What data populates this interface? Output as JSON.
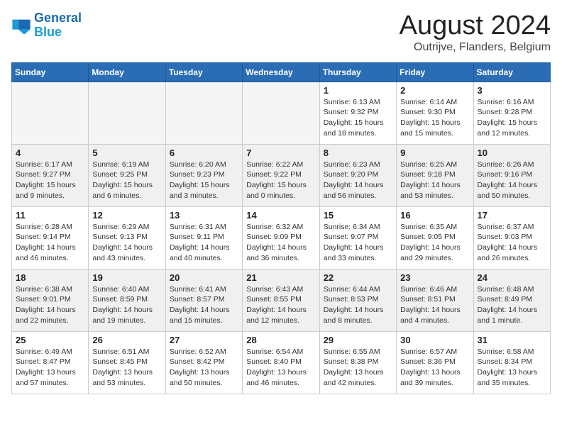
{
  "logo": {
    "line1": "General",
    "line2": "Blue"
  },
  "title": "August 2024",
  "location": "Outrijve, Flanders, Belgium",
  "weekdays": [
    "Sunday",
    "Monday",
    "Tuesday",
    "Wednesday",
    "Thursday",
    "Friday",
    "Saturday"
  ],
  "weeks": [
    [
      {
        "day": "",
        "info": ""
      },
      {
        "day": "",
        "info": ""
      },
      {
        "day": "",
        "info": ""
      },
      {
        "day": "",
        "info": ""
      },
      {
        "day": "1",
        "info": "Sunrise: 6:13 AM\nSunset: 9:32 PM\nDaylight: 15 hours\nand 18 minutes."
      },
      {
        "day": "2",
        "info": "Sunrise: 6:14 AM\nSunset: 9:30 PM\nDaylight: 15 hours\nand 15 minutes."
      },
      {
        "day": "3",
        "info": "Sunrise: 6:16 AM\nSunset: 9:28 PM\nDaylight: 15 hours\nand 12 minutes."
      }
    ],
    [
      {
        "day": "4",
        "info": "Sunrise: 6:17 AM\nSunset: 9:27 PM\nDaylight: 15 hours\nand 9 minutes."
      },
      {
        "day": "5",
        "info": "Sunrise: 6:19 AM\nSunset: 9:25 PM\nDaylight: 15 hours\nand 6 minutes."
      },
      {
        "day": "6",
        "info": "Sunrise: 6:20 AM\nSunset: 9:23 PM\nDaylight: 15 hours\nand 3 minutes."
      },
      {
        "day": "7",
        "info": "Sunrise: 6:22 AM\nSunset: 9:22 PM\nDaylight: 15 hours\nand 0 minutes."
      },
      {
        "day": "8",
        "info": "Sunrise: 6:23 AM\nSunset: 9:20 PM\nDaylight: 14 hours\nand 56 minutes."
      },
      {
        "day": "9",
        "info": "Sunrise: 6:25 AM\nSunset: 9:18 PM\nDaylight: 14 hours\nand 53 minutes."
      },
      {
        "day": "10",
        "info": "Sunrise: 6:26 AM\nSunset: 9:16 PM\nDaylight: 14 hours\nand 50 minutes."
      }
    ],
    [
      {
        "day": "11",
        "info": "Sunrise: 6:28 AM\nSunset: 9:14 PM\nDaylight: 14 hours\nand 46 minutes."
      },
      {
        "day": "12",
        "info": "Sunrise: 6:29 AM\nSunset: 9:13 PM\nDaylight: 14 hours\nand 43 minutes."
      },
      {
        "day": "13",
        "info": "Sunrise: 6:31 AM\nSunset: 9:11 PM\nDaylight: 14 hours\nand 40 minutes."
      },
      {
        "day": "14",
        "info": "Sunrise: 6:32 AM\nSunset: 9:09 PM\nDaylight: 14 hours\nand 36 minutes."
      },
      {
        "day": "15",
        "info": "Sunrise: 6:34 AM\nSunset: 9:07 PM\nDaylight: 14 hours\nand 33 minutes."
      },
      {
        "day": "16",
        "info": "Sunrise: 6:35 AM\nSunset: 9:05 PM\nDaylight: 14 hours\nand 29 minutes."
      },
      {
        "day": "17",
        "info": "Sunrise: 6:37 AM\nSunset: 9:03 PM\nDaylight: 14 hours\nand 26 minutes."
      }
    ],
    [
      {
        "day": "18",
        "info": "Sunrise: 6:38 AM\nSunset: 9:01 PM\nDaylight: 14 hours\nand 22 minutes."
      },
      {
        "day": "19",
        "info": "Sunrise: 6:40 AM\nSunset: 8:59 PM\nDaylight: 14 hours\nand 19 minutes."
      },
      {
        "day": "20",
        "info": "Sunrise: 6:41 AM\nSunset: 8:57 PM\nDaylight: 14 hours\nand 15 minutes."
      },
      {
        "day": "21",
        "info": "Sunrise: 6:43 AM\nSunset: 8:55 PM\nDaylight: 14 hours\nand 12 minutes."
      },
      {
        "day": "22",
        "info": "Sunrise: 6:44 AM\nSunset: 8:53 PM\nDaylight: 14 hours\nand 8 minutes."
      },
      {
        "day": "23",
        "info": "Sunrise: 6:46 AM\nSunset: 8:51 PM\nDaylight: 14 hours\nand 4 minutes."
      },
      {
        "day": "24",
        "info": "Sunrise: 6:48 AM\nSunset: 8:49 PM\nDaylight: 14 hours\nand 1 minute."
      }
    ],
    [
      {
        "day": "25",
        "info": "Sunrise: 6:49 AM\nSunset: 8:47 PM\nDaylight: 13 hours\nand 57 minutes."
      },
      {
        "day": "26",
        "info": "Sunrise: 6:51 AM\nSunset: 8:45 PM\nDaylight: 13 hours\nand 53 minutes."
      },
      {
        "day": "27",
        "info": "Sunrise: 6:52 AM\nSunset: 8:42 PM\nDaylight: 13 hours\nand 50 minutes."
      },
      {
        "day": "28",
        "info": "Sunrise: 6:54 AM\nSunset: 8:40 PM\nDaylight: 13 hours\nand 46 minutes."
      },
      {
        "day": "29",
        "info": "Sunrise: 6:55 AM\nSunset: 8:38 PM\nDaylight: 13 hours\nand 42 minutes."
      },
      {
        "day": "30",
        "info": "Sunrise: 6:57 AM\nSunset: 8:36 PM\nDaylight: 13 hours\nand 39 minutes."
      },
      {
        "day": "31",
        "info": "Sunrise: 6:58 AM\nSunset: 8:34 PM\nDaylight: 13 hours\nand 35 minutes."
      }
    ]
  ],
  "colors": {
    "header_bg": "#2a6db5",
    "row_alt": "#f0f0f0"
  }
}
